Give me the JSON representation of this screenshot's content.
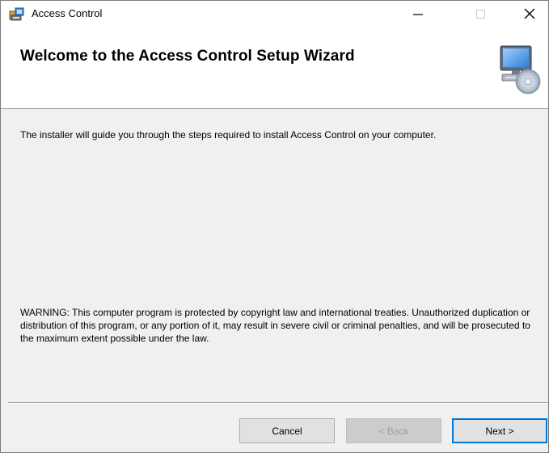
{
  "window": {
    "title": "Access Control",
    "minimize_glyph": "—",
    "maximize_glyph": "☐",
    "close_glyph": "✕"
  },
  "header": {
    "title": "Welcome to the Access Control Setup Wizard",
    "icon": "computer-cd-icon"
  },
  "body": {
    "intro": "The installer will guide you through the steps required to install Access Control on your computer.",
    "warning": "WARNING: This computer program is protected by copyright law and international treaties. Unauthorized duplication or distribution of this program, or any portion of it, may result in severe civil or criminal penalties, and will be prosecuted to the maximum extent possible under the law."
  },
  "buttons": {
    "cancel": "Cancel",
    "back": "< Back",
    "next": "Next >"
  },
  "colors": {
    "accent": "#0078d7",
    "window_bg": "#f0f0f0",
    "header_bg": "#ffffff",
    "disabled_text": "#a0a0a0"
  }
}
